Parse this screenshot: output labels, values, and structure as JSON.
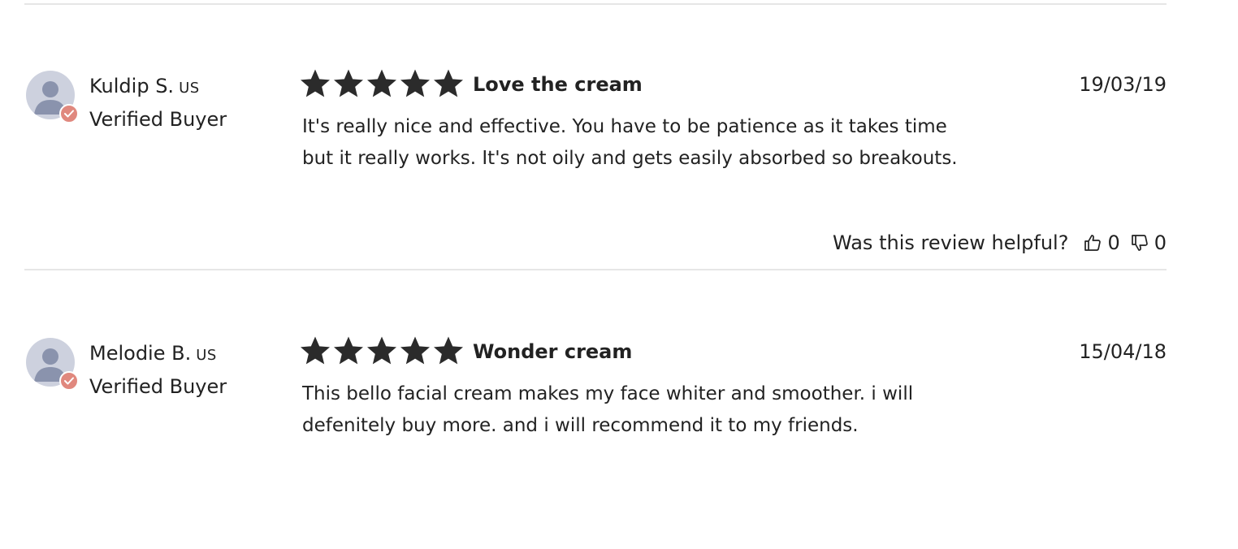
{
  "icons": {
    "avatar": "user-silhouette-icon",
    "verified": "check-badge-icon",
    "star": "star-icon",
    "thumb_up": "thumbs-up-icon",
    "thumb_down": "thumbs-down-icon"
  },
  "colors": {
    "text": "#222222",
    "divider": "#e6e6e6",
    "avatar_bg": "#cdd1de",
    "avatar_figure": "#8a93ad",
    "verified_badge": "#e0887e",
    "star": "#2b2b2b"
  },
  "reviews": [
    {
      "author": "Kuldip S.",
      "country": "US",
      "buyer_label": "Verified Buyer",
      "rating": 5,
      "title": "Love the cream",
      "date": "19/03/19",
      "body_line_1": "It's really nice and effective. You have to be patience as it takes time",
      "body_line_2": "but it really works. It's not oily and gets easily absorbed so breakouts.",
      "helpful_prompt": "Was this review helpful?",
      "helpful_up_count": "0",
      "helpful_down_count": "0"
    },
    {
      "author": "Melodie B.",
      "country": "US",
      "buyer_label": "Verified Buyer",
      "rating": 5,
      "title": "Wonder cream",
      "date": "15/04/18",
      "body_line_1": "This bello facial cream makes my face whiter and smoother. i will",
      "body_line_2": "defenitely buy more. and i will recommend it to my friends."
    }
  ]
}
